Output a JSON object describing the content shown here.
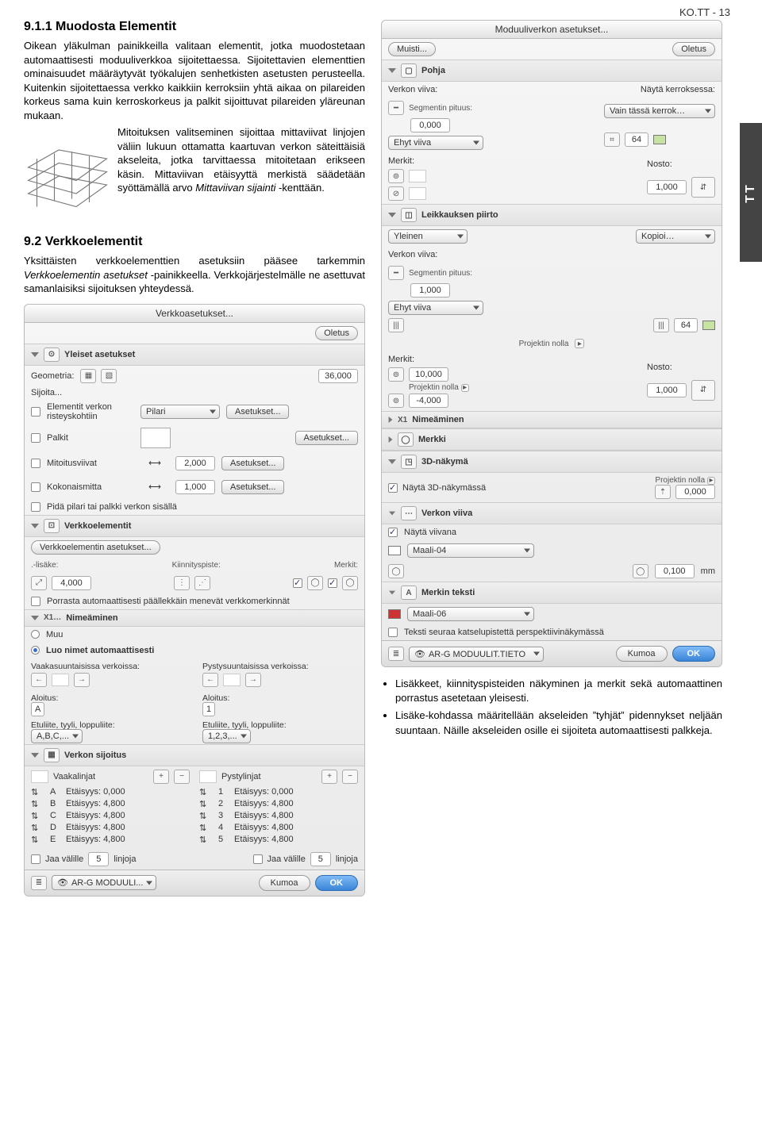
{
  "header": {
    "page_tag": "KO.TT - 13",
    "side_tab": "TT"
  },
  "text": {
    "h911": "9.1.1  Muodosta Elementit",
    "p1": "Oikean yläkulman painikkeilla valitaan elementit, jotka muodostetaan automaattisesti moduuliverkkoa sijoitettaessa. Sijoitettavien elementtien ominaisuudet määräytyvät työkalujen senhetkisten asetusten perusteella. Kuitenkin sijoitettaessa verkko kaikkiin kerroksiin yhtä aikaa on pilareiden korkeus sama kuin kerroskorkeus ja palkit sijoittuvat pilareiden yläreunan mukaan.",
    "p2": "Mitoituksen valitseminen sijoittaa mittaviivat linjojen väliin lukuun ottamatta kaartuvan verkon säteittäisiä akseleita, jotka tarvittaessa mitoitetaan erikseen käsin. Mittaviivan etäisyyttä merkistä säädetään syöttämällä arvo ",
    "p2_it": "Mittaviivan sijainti",
    "p2_end": " -kenttään.",
    "h92": "9.2  Verkkoelementit",
    "p3a": "Yksittäisten verkkoelementtien asetuksiin pääsee tarkemmin ",
    "p3_it": "Verkkoelementin asetukset",
    "p3b": " -painikkeella. Verkkojärjestelmälle ne asettuvat samanlaisiksi sijoituksen yhteydessä.",
    "bul1": "Lisäkkeet, kiinnityspisteiden näkyminen ja merkit sekä automaattinen porrastus asetetaan yleisesti.",
    "bul2": "Lisäke-kohdassa määritellään akseleiden ”tyhjät” pidennykset neljään suuntaan. Näille akseleiden osille ei sijoiteta automaattisesti palkkeja."
  },
  "panelA": {
    "title": "Verkkoasetukset...",
    "oletus": "Oletus",
    "sect_general": "Yleiset asetukset",
    "geometria": "Geometria:",
    "geom_val": "36,000",
    "sijoita": "Sijoita...",
    "el_verkon": "Elementit verkon risteyskohtiin",
    "pilari": "Pilari",
    "asetukset": "Asetukset...",
    "palkit": "Palkit",
    "mitoitus": "Mitoitusviivat",
    "mitoitus_val": "2,000",
    "kokonais": "Kokonaismitta",
    "kokonais_val": "1,000",
    "pida": "Pidä pilari tai palkki verkon sisällä",
    "sect_verkko": "Verkkoelementit",
    "verkko_btn": "Verkkoelementin asetukset...",
    "lisake": ".-lisäke:",
    "kiinnitys": "Kiinnityspiste:",
    "merkit": "Merkit:",
    "lisake_val": "4,000",
    "porrasta": "Porrasta automaattisesti päällekkäin menevät verkkomerkinnät",
    "sect_nimeaminen": "Nimeäminen",
    "muu": "Muu",
    "luo": "Luo nimet automaattisesti",
    "vaaka": "Vaakasuuntaisissa verkoissa:",
    "pysty": "Pystysuuntaisissa verkoissa:",
    "aloitus": "Aloitus:",
    "aloitus_a": "A",
    "aloitus_1": "1",
    "etuliite": "Etuliite, tyyli, loppuliite:",
    "abc": "A,B,C,...",
    "n123": "1,2,3,...",
    "sect_sijoitus": "Verkon sijoitus",
    "vaakalinjat": "Vaakalinjat",
    "pystylinjat": "Pystylinjat",
    "hrows": [
      {
        "k": "A",
        "d": "Etäisyys: 0,000"
      },
      {
        "k": "B",
        "d": "Etäisyys: 4,800"
      },
      {
        "k": "C",
        "d": "Etäisyys: 4,800"
      },
      {
        "k": "D",
        "d": "Etäisyys: 4,800"
      },
      {
        "k": "E",
        "d": "Etäisyys: 4,800"
      }
    ],
    "vrows": [
      {
        "k": "1",
        "d": "Etäisyys: 0,000"
      },
      {
        "k": "2",
        "d": "Etäisyys: 4,800"
      },
      {
        "k": "3",
        "d": "Etäisyys: 4,800"
      },
      {
        "k": "4",
        "d": "Etäisyys: 4,800"
      },
      {
        "k": "5",
        "d": "Etäisyys: 4,800"
      }
    ],
    "jaa": "Jaa välille",
    "jaa_val": "5",
    "linjoja": "linjoja",
    "layer": "AR-G MODUULI...",
    "kumoa": "Kumoa",
    "ok": "OK"
  },
  "panelB": {
    "title": "Moduuliverkon asetukset...",
    "muisti": "Muisti...",
    "oletus": "Oletus",
    "sect_pohja": "Pohja",
    "verkon_viiva": "Verkon viiva:",
    "nayta_kerr": "Näytä kerroksessa:",
    "kerr_val": "Vain tässä kerrok…",
    "seg": "Segmentin pituus:",
    "seg_val": "0,000",
    "ehyt": "Ehyt viiva",
    "num64": "64",
    "merkit": "Merkit:",
    "nosto": "Nosto:",
    "nosto_val": "1,000",
    "sect_leikkaus": "Leikkauksen piirto",
    "yleinen": "Yleinen",
    "kopioi": "Kopioi…",
    "seg2": "Segmentin pituus:",
    "seg2_val": "1,000",
    "ehyt2": "Ehyt viiva",
    "num64b": "64",
    "proj_nolla": "Projektin nolla",
    "merkit2": "Merkit:",
    "merkit2_val": "10,000",
    "merkit2_val2": "-4,000",
    "nosto2": "Nosto:",
    "nosto2_val": "1,000",
    "sect_nime": "Nimeäminen",
    "sect_merkki": "Merkki",
    "sect_3d": "3D-näkymä",
    "nayta_3d": "Näytä 3D-näkymässä",
    "proj_nolla2": "Projektin nolla",
    "pn_val": "0,000",
    "sect_vv": "Verkon viiva",
    "nayta_viivana": "Näytä viivana",
    "maali04": "Maali-04",
    "pen": "0,100",
    "mm": "mm",
    "sect_mt": "Merkin teksti",
    "maali06": "Maali-06",
    "teksti_seuraa": "Teksti seuraa katselupistettä perspektiivinäkymässä",
    "layer": "AR-G MODUULIT.TIETO",
    "kumoa": "Kumoa",
    "ok": "OK"
  }
}
